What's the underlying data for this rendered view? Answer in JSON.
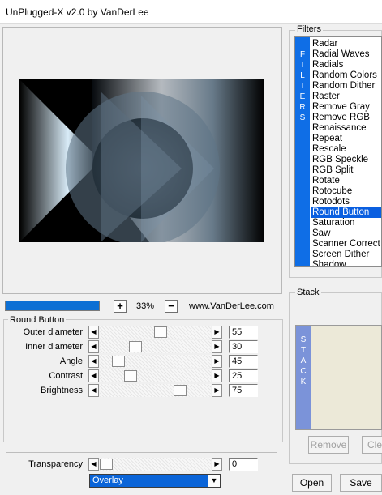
{
  "window": {
    "title": "UnPlugged-X v2.0 by VanDerLee"
  },
  "preview": {
    "progress": 1.0,
    "zoom": "33%",
    "zoom_in": "+",
    "zoom_out": "−",
    "website": "www.VanDerLee.com"
  },
  "params": {
    "title": "Round Button",
    "sliders": [
      {
        "label": "Outer diameter",
        "value": "55",
        "level": 0.55
      },
      {
        "label": "Inner diameter",
        "value": "30",
        "level": 0.3
      },
      {
        "label": "Angle",
        "value": "45",
        "level": 0.125
      },
      {
        "label": "Contrast",
        "value": "25",
        "level": 0.25
      },
      {
        "label": "Brightness",
        "value": "75",
        "level": 0.75
      }
    ],
    "transparency": {
      "label": "Transparency",
      "value": "0",
      "level": 0.0
    },
    "blend_mode": "Overlay"
  },
  "filters": {
    "title": "Filters",
    "strip": "FILTERS",
    "items": [
      "Radar",
      "Radial Waves",
      "Radials",
      "Random Colors",
      "Random Dither",
      "Raster",
      "Remove Gray",
      "Remove RGB",
      "Renaissance",
      "Repeat",
      "Rescale",
      "RGB Speckle",
      "RGB Split",
      "Rotate",
      "Rotocube",
      "Rotodots",
      "Round Button",
      "Saturation",
      "Saw",
      "Scanner Correct",
      "Screen Dither",
      "Shadow"
    ],
    "selected": "Round Button"
  },
  "stack": {
    "title": "Stack",
    "strip": "STACK",
    "remove": "Remove",
    "clear": "Clear"
  },
  "buttons": {
    "open": "Open",
    "save": "Save"
  },
  "icons": {
    "left_arrow": "arrow-left-icon",
    "right_arrow": "arrow-right-icon",
    "dropdown": "chevron-down-icon"
  },
  "colors": {
    "accent": "#0a5fe0",
    "strip": "#0f6ee6",
    "stack_strip": "#7b93d9"
  }
}
